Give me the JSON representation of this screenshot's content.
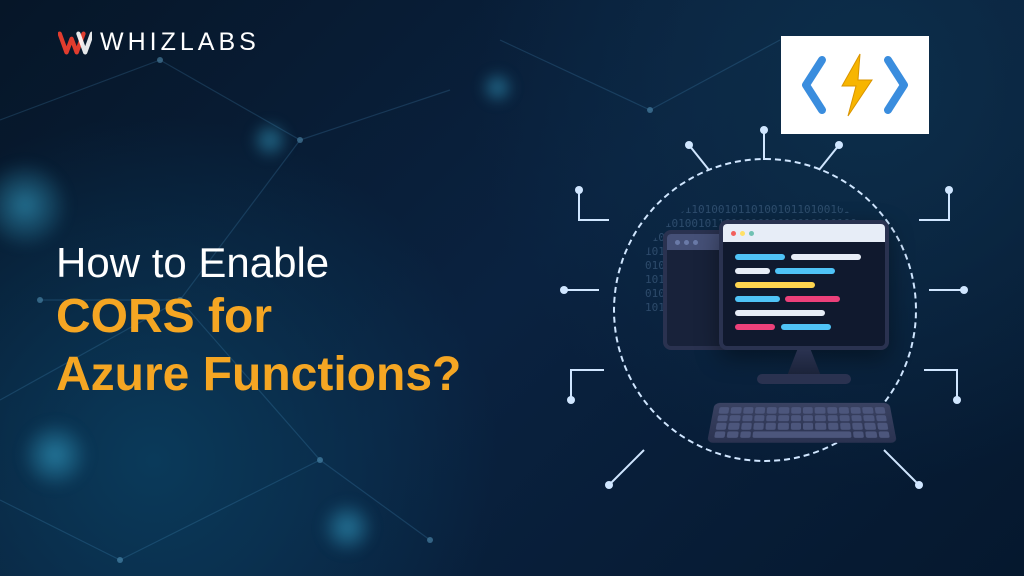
{
  "brand": {
    "name": "WHIZLABS"
  },
  "headline": {
    "line1": "How to Enable",
    "line2": "CORS for",
    "line3": "Azure Functions?"
  },
  "colors": {
    "accent": "#f5a623",
    "text": "#ffffff",
    "bolt": "#f7b500",
    "bracket": "#3a8dde"
  },
  "illustration": {
    "badge_icon": "azure-functions-icon",
    "binary_fill": "0100101101001011010010110100101101001011010010110100101101001011010010110100101101001011010010110100101101001011010010110100101101001011010010110100101101001011010010110100101101001011010010110100101101001011010010110100101101001011010010110100101101001011"
  }
}
